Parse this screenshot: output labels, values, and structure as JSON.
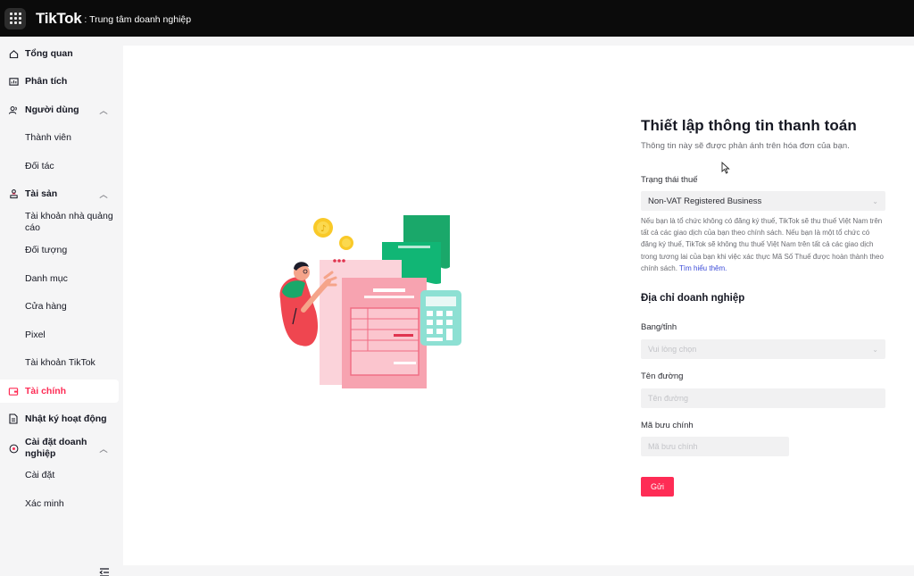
{
  "header": {
    "brand": "TikTok",
    "subtitle": ": Trung tâm doanh nghiệp"
  },
  "sidebar": {
    "items": [
      {
        "label": "Tổng quan",
        "icon": "home-icon"
      },
      {
        "label": "Phân tích",
        "icon": "chart-icon"
      },
      {
        "label": "Người dùng",
        "icon": "users-icon"
      },
      {
        "label": "Thành viên"
      },
      {
        "label": "Đối tác"
      },
      {
        "label": "Tài sản",
        "icon": "assets-icon"
      },
      {
        "label": "Tài khoản nhà quảng cáo"
      },
      {
        "label": "Đối tượng"
      },
      {
        "label": "Danh mục"
      },
      {
        "label": "Cửa hàng"
      },
      {
        "label": "Pixel"
      },
      {
        "label": "Tài khoản TikTok"
      },
      {
        "label": "Tài chính",
        "icon": "finance-icon"
      },
      {
        "label": "Nhật ký hoạt động",
        "icon": "log-icon"
      },
      {
        "label": "Cài đặt doanh nghiệp",
        "icon": "settings-icon"
      },
      {
        "label": "Cài đặt"
      },
      {
        "label": "Xác minh"
      }
    ]
  },
  "form": {
    "title": "Thiết lập thông tin thanh toán",
    "subtitle": "Thông tin này sẽ được phản ánh trên hóa đơn của bạn.",
    "tax_status_label": "Trạng thái thuế",
    "tax_status_value": "Non-VAT Registered Business",
    "tax_note": "Nếu bạn là tổ chức không có đăng ký thuế, TikTok sẽ thu thuế Việt Nam trên tất cả các giao dịch của bạn theo chính sách. Nếu bạn là một tổ chức có đăng ký thuế, TikTok sẽ không thu thuế Việt Nam trên tất cả các giao dịch trong tương lai của bạn khi việc xác thực Mã Số Thuế được hoàn thành theo chính sách.",
    "learn_more": "Tìm hiểu thêm.",
    "address_title": "Địa chỉ doanh nghiệp",
    "state_label": "Bang/tỉnh",
    "state_placeholder": "Vui lòng chọn",
    "street_label": "Tên đường",
    "street_placeholder": "Tên đường",
    "postal_label": "Mã bưu chính",
    "postal_placeholder": "Mã bưu chính",
    "submit_label": "Gửi"
  },
  "colors": {
    "accent": "#fe2c55",
    "topbar": "#0b0b0b",
    "link": "#3b4bd8"
  }
}
